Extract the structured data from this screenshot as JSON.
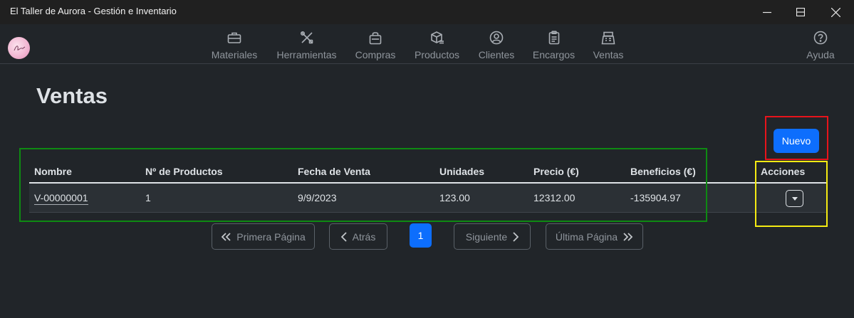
{
  "window": {
    "title": "El Taller de Aurora - Gestión e Inventario"
  },
  "nav": {
    "items": [
      {
        "label": "Materiales",
        "icon": "briefcase-icon"
      },
      {
        "label": "Herramientas",
        "icon": "tools-icon"
      },
      {
        "label": "Compras",
        "icon": "shopping-bag-icon"
      },
      {
        "label": "Productos",
        "icon": "box-icon"
      },
      {
        "label": "Clientes",
        "icon": "user-circle-icon"
      },
      {
        "label": "Encargos",
        "icon": "clipboard-icon"
      },
      {
        "label": "Ventas",
        "icon": "cash-register-icon"
      }
    ],
    "help": {
      "label": "Ayuda",
      "icon": "question-circle-icon"
    }
  },
  "page": {
    "title": "Ventas",
    "new_button": "Nuevo"
  },
  "table": {
    "headers": [
      "Nombre",
      "Nº de Productos",
      "Fecha de Venta",
      "Unidades",
      "Precio (€)",
      "Beneficios (€)",
      "Acciones"
    ],
    "rows": [
      {
        "nombre": "V-00000001",
        "num_productos": "1",
        "fecha": "9/9/2023",
        "unidades": "123.00",
        "precio": "12312.00",
        "beneficios": "-135904.97"
      }
    ]
  },
  "pagination": {
    "first": "Primera Página",
    "prev": "Atrás",
    "current": "1",
    "next": "Siguiente",
    "last": "Última Página"
  },
  "colors": {
    "background": "#212529",
    "accent": "#0d6efd",
    "highlight_red": "#e8141b",
    "highlight_green": "#0e8a12",
    "highlight_yellow": "#f5eb12"
  }
}
